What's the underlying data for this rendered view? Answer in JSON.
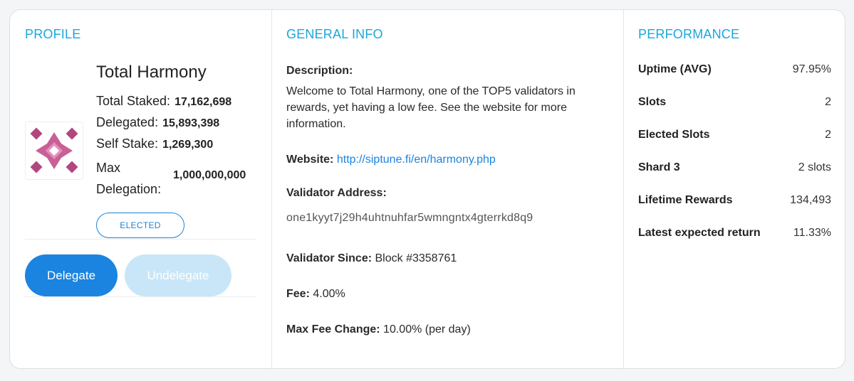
{
  "profile": {
    "section_title": "PROFILE",
    "name": "Total Harmony",
    "total_staked_label": "Total Staked:",
    "total_staked_value": "17,162,698",
    "delegated_label": "Delegated:",
    "delegated_value": "15,893,398",
    "self_stake_label": "Self Stake:",
    "self_stake_value": "1,269,300",
    "max_delegation_label": "Max Delegation:",
    "max_delegation_value": "1,000,000,000",
    "status_badge": "ELECTED",
    "delegate_button": "Delegate",
    "undelegate_button": "Undelegate",
    "logo_color": "#b2477d"
  },
  "general": {
    "section_title": "GENERAL INFO",
    "description_label": "Description:",
    "description_text": "Welcome to Total Harmony, one of the TOP5 validators in rewards, yet having a low fee. See the website for more information.",
    "website_label": "Website:",
    "website_url": "http://siptune.fi/en/harmony.php",
    "validator_address_label": "Validator Address:",
    "validator_address": "one1kyyt7j29h4uhtnuhfar5wmngntx4gterrkd8q9",
    "validator_since_label": "Validator Since:",
    "validator_since_value": "Block #3358761",
    "fee_label": "Fee:",
    "fee_value": "4.00%",
    "max_fee_change_label": "Max Fee Change:",
    "max_fee_change_value": "10.00% (per day)"
  },
  "performance": {
    "section_title": "PERFORMANCE",
    "rows": [
      {
        "label": "Uptime (AVG)",
        "value": "97.95%"
      },
      {
        "label": "Slots",
        "value": "2"
      },
      {
        "label": "Elected Slots",
        "value": "2"
      },
      {
        "label": "Shard 3",
        "value": "2 slots"
      },
      {
        "label": "Lifetime Rewards",
        "value": "134,493"
      },
      {
        "label": "Latest expected return",
        "value": "11.33%"
      }
    ]
  },
  "colors": {
    "accent": "#1aa7dc",
    "primary_button": "#1b84e0",
    "disabled_button": "#c8e6f7"
  }
}
